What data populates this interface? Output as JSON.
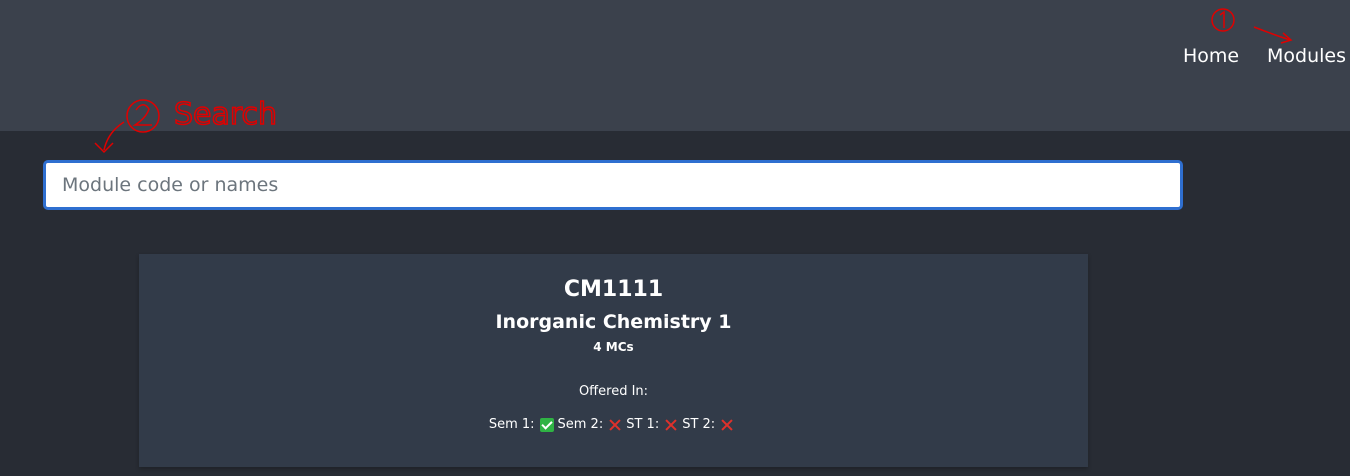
{
  "nav": {
    "home_label": "Home",
    "modules_label": "Modules"
  },
  "annotations": {
    "step1": "①",
    "step2": "②",
    "search_note": "Search"
  },
  "search": {
    "placeholder": "Module code or names",
    "value": ""
  },
  "module": {
    "code": "CM1111",
    "name": "Inorganic Chemistry 1",
    "mcs": "4 MCs",
    "offered_label": "Offered In:",
    "semesters": [
      {
        "label": "Sem 1:",
        "offered": true,
        "icon": "check-icon"
      },
      {
        "label": "Sem 2:",
        "offered": false,
        "icon": "cross-icon"
      },
      {
        "label": "ST 1:",
        "offered": false,
        "icon": "cross-icon"
      },
      {
        "label": "ST 2:",
        "offered": false,
        "icon": "cross-icon"
      }
    ]
  },
  "colors": {
    "navbar_bg": "#3b414c",
    "page_bg": "#282c34",
    "card_bg": "#323b49",
    "search_border": "#2f6fd0",
    "offered": "#2fb344",
    "not_offered": "#e0312b",
    "annotation": "#e00000"
  }
}
